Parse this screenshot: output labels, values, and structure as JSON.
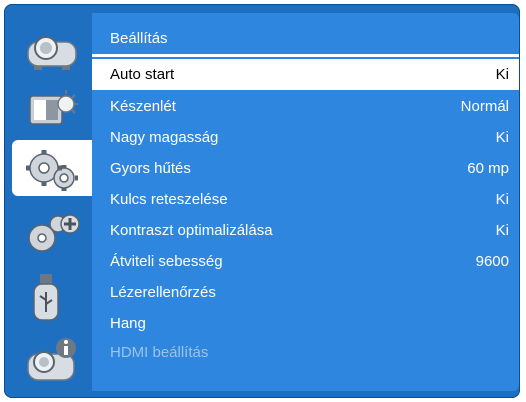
{
  "panel": {
    "title": "Beállítás"
  },
  "menu": [
    {
      "label": "Auto start",
      "value": "Ki"
    },
    {
      "label": "Készenlét",
      "value": "Normál"
    },
    {
      "label": "Nagy magasság",
      "value": "Ki"
    },
    {
      "label": "Gyors hűtés",
      "value": "60 mp"
    },
    {
      "label": "Kulcs reteszelése",
      "value": "Ki"
    },
    {
      "label": "Kontraszt optimalizálása",
      "value": "Ki"
    },
    {
      "label": "Átviteli sebesség",
      "value": "9600"
    },
    {
      "label": "Lézerellenőrzés",
      "value": ""
    },
    {
      "label": "Hang",
      "value": ""
    },
    {
      "label": "HDMI beállítás",
      "value": ""
    }
  ],
  "sidebar": [
    {
      "icon": "projector-icon"
    },
    {
      "icon": "display-brightness-icon"
    },
    {
      "icon": "gears-settings-icon"
    },
    {
      "icon": "gears-plus-icon"
    },
    {
      "icon": "usb-drive-icon"
    },
    {
      "icon": "projector-info-icon"
    }
  ],
  "colors": {
    "frame": "#1f6fc1",
    "panel": "#2f86de",
    "selected_row": "#ffffff"
  }
}
